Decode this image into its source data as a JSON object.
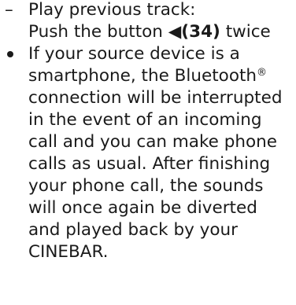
{
  "list": {
    "dash_item": {
      "marker": "–",
      "line1": "Play previous track:",
      "line2_prefix": "Push the button ",
      "button_glyph": "◀",
      "button_ref": "(34)",
      "line2_suffix": " twice"
    },
    "bullet_item": {
      "lines": [
        "If your source device is a",
        "smartphone, the Bluetooth",
        "connection will be interrupted",
        "in the event of an incoming",
        "call and you can make phone",
        "calls as usual. After finishing",
        "your phone call, the sounds",
        "will once again be diverted",
        "and played back by your",
        "CINEBAR."
      ],
      "registered_mark": "®"
    }
  }
}
